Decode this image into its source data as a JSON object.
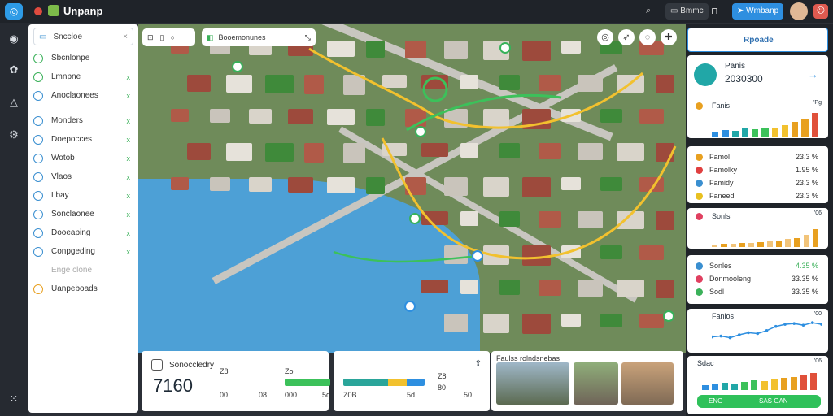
{
  "app": {
    "title": "Unpanp",
    "browse_label": "Bmmc",
    "nav_button": "Wmbanp"
  },
  "sidebar": {
    "search_label": "Snccloe",
    "items": [
      {
        "label": "Sbcnlonpe",
        "mark": ""
      },
      {
        "label": "Lmnpne",
        "mark": "x"
      },
      {
        "label": "Anoclaonees",
        "mark": "x"
      },
      {
        "label": "Monders",
        "mark": "x"
      },
      {
        "label": "Doepocces",
        "mark": "x"
      },
      {
        "label": "Wotob",
        "mark": "x"
      },
      {
        "label": "Vlaos",
        "mark": "x"
      },
      {
        "label": "Lbay",
        "mark": "x"
      },
      {
        "label": "Sonclaonee",
        "mark": "x"
      },
      {
        "label": "Dooeaping",
        "mark": "x"
      },
      {
        "label": "Conpgeding",
        "mark": "x"
      },
      {
        "label": "Enge clone",
        "mark": ""
      },
      {
        "label": "Uanpeboads",
        "mark": ""
      }
    ]
  },
  "map": {
    "search_label": "Booemonunes"
  },
  "right_panel": {
    "header": "Rpoade",
    "summary": {
      "title": "Panis",
      "value": "2030300",
      "arrow": "→"
    },
    "card1": {
      "title": "Fanis",
      "corner": "'Pg",
      "bars": [
        20,
        25,
        22,
        30,
        28,
        35,
        33,
        45,
        55,
        70,
        92
      ]
    },
    "list1": [
      {
        "label": "Famol",
        "value": "23.3 %",
        "color": "#e8a020"
      },
      {
        "label": "Famolky",
        "value": "1.95 %",
        "color": "#e04040"
      },
      {
        "label": "Famidy",
        "value": "23.3 %",
        "color": "#3a8fd0"
      },
      {
        "label": "Faneedl",
        "value": "23.3 %",
        "color": "#e8c020"
      }
    ],
    "card2": {
      "title": "Sonls",
      "corner": "'06",
      "bars": [
        10,
        12,
        14,
        15,
        17,
        20,
        22,
        25,
        30,
        35,
        48,
        70
      ]
    },
    "list2": [
      {
        "label": "Sonles",
        "value": "4.35 %",
        "color": "#3a8fd0",
        "value_color": "#3bb15a"
      },
      {
        "label": "Donmooleng",
        "value": "33.35 %",
        "color": "#e04060",
        "value_color": "#333333"
      },
      {
        "label": "Sodl",
        "value": "33.35 %",
        "color": "#3bb15a",
        "value_color": "#333333"
      }
    ],
    "card3": {
      "title": "Fanios",
      "corner": "'00",
      "line": [
        30,
        32,
        28,
        35,
        40,
        38,
        45,
        55,
        60,
        62,
        58,
        64,
        60
      ]
    },
    "card4": {
      "title": "Sdac",
      "corner": "'06",
      "bars": [
        20,
        25,
        30,
        28,
        35,
        40,
        38,
        45,
        50,
        55,
        60,
        70
      ],
      "button_left": "ENG",
      "button_right": "SAS GAN"
    }
  },
  "bottom": {
    "card1": {
      "title": "Sonoccledry",
      "value": "7160",
      "items": [
        "Z8",
        "00",
        "08"
      ]
    },
    "card2": {
      "labels_top": [
        "Zol",
        "Zol"
      ],
      "values_left": [
        "000",
        "5d"
      ]
    },
    "card3": {
      "values": [
        "Z0B",
        "5d",
        "000",
        "5d"
      ],
      "right": [
        "Z8",
        "80",
        "50"
      ]
    },
    "gallery": {
      "title": "Faulss rolndsnebas"
    }
  }
}
